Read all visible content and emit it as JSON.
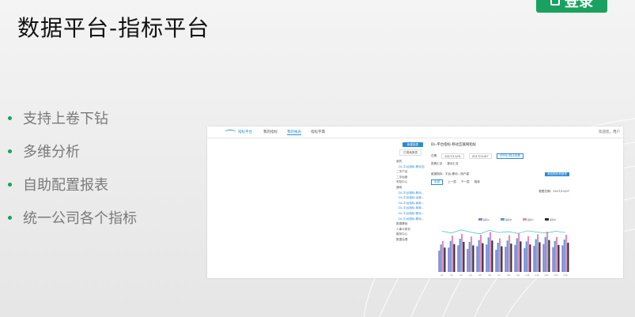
{
  "top_button": {
    "label": "登录"
  },
  "slide": {
    "title": "数据平台-指标平台",
    "bullets": [
      "支持上卷下钻",
      "多维分析",
      "自助配置报表",
      "统一公司各个指标"
    ]
  },
  "screenshot": {
    "logo_text": "指标平台",
    "nav_tabs": [
      "我的指标",
      "我的报表",
      "指标字典"
    ],
    "user_text": "欢迎您，用户",
    "side": {
      "new_btn": "新建报表",
      "search_label": "已搜索报表",
      "items": [
        "我的",
        "DL-平台指标-移动互联…",
        "二手产品",
        "二手运营",
        "车险中心",
        "通用",
        "DL-平台指标-移动…",
        "DL-平台指标-运营…",
        "DL-平台指标-商家…",
        "DL-平台指标-商家…",
        "DL-平台指标-移动…",
        "DL-平台指标-移动…",
        "数据基础",
        "人事与财务",
        "服务中心",
        "数据治理"
      ]
    },
    "main": {
      "report_title": "DL-平台指标-移动互联网指标",
      "date_label": "日期",
      "date_from": "2017/11/01",
      "date_to": "2017/11/07",
      "compare_btn": "日环比/同比查看",
      "options": [
        "按周汇总",
        "按月汇总"
      ],
      "breadcrumb": "维度指标：平台-移动…用户量",
      "add_btn": "添加指标到报表",
      "tabs": [
        "全部",
        "指标"
      ],
      "drill": [
        "上一层",
        "下一层"
      ],
      "chart_date": "数据日期：2017/11/07"
    }
  },
  "chart_data": {
    "type": "bar",
    "legend": [
      "指标A",
      "指标B",
      "指标C",
      "指标D"
    ],
    "colors": [
      "#8a7fd6",
      "#5c9ad6",
      "#e88bb5",
      "#2a2a3a"
    ],
    "categories": [
      "C1",
      "C2",
      "C3",
      "C4",
      "C5",
      "C6",
      "C7",
      "C8",
      "C9",
      "C10",
      "C11",
      "C12",
      "C13",
      "C14"
    ],
    "series": [
      {
        "values": [
          48,
          55,
          60,
          52,
          58,
          62,
          50,
          57,
          61,
          54,
          59,
          63,
          56,
          60
        ]
      },
      {
        "values": [
          62,
          70,
          75,
          68,
          72,
          78,
          66,
          71,
          76,
          69,
          74,
          79,
          70,
          73
        ]
      },
      {
        "values": [
          70,
          82,
          86,
          80,
          84,
          90,
          76,
          83,
          88,
          81,
          85,
          91,
          79,
          84
        ]
      },
      {
        "values": [
          55,
          63,
          68,
          60,
          65,
          71,
          58,
          64,
          69,
          62,
          67,
          72,
          61,
          66
        ]
      }
    ],
    "line": {
      "color": "#3cc4c0",
      "values": [
        92,
        88,
        95,
        90,
        86,
        94,
        89,
        91,
        87,
        93,
        90,
        88,
        92,
        89
      ]
    },
    "ylim": [
      0,
      100
    ]
  }
}
